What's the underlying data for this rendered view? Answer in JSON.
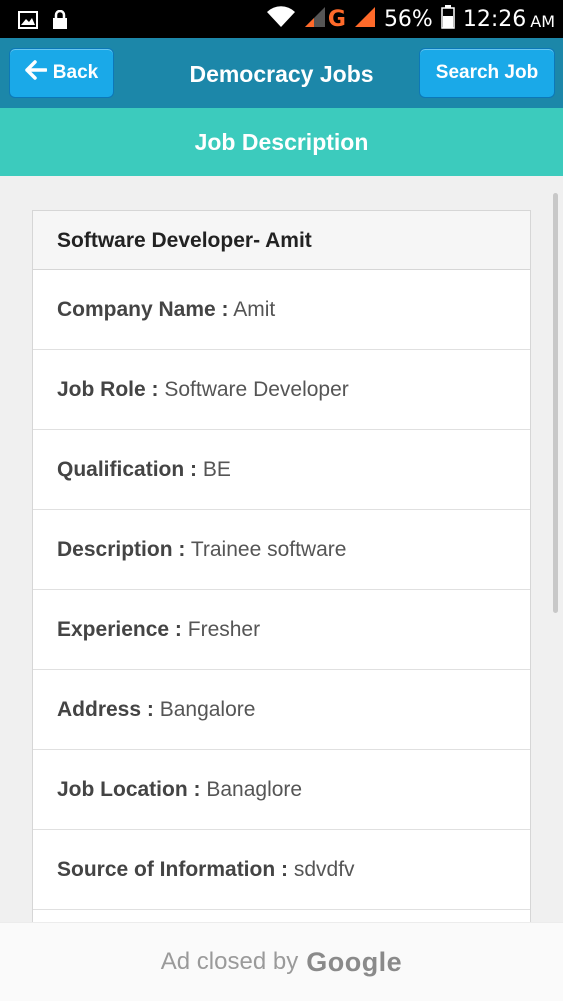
{
  "status_bar": {
    "battery": "56%",
    "time": "12:26",
    "ampm": "AM",
    "network_letter": "G",
    "icons": [
      "image-icon",
      "lock-icon",
      "wifi-icon",
      "signal-icon",
      "signal-icon",
      "battery-icon"
    ]
  },
  "header": {
    "back_label": "Back",
    "title": "Democracy Jobs",
    "search_label": "Search Job"
  },
  "subheader": {
    "title": "Job Description"
  },
  "job": {
    "title": "Software Developer- Amit",
    "fields": [
      {
        "label": "Company Name :",
        "value": "Amit"
      },
      {
        "label": "Job Role :",
        "value": "Software Developer"
      },
      {
        "label": "Qualification :",
        "value": "BE"
      },
      {
        "label": "Description :",
        "value": "Trainee software"
      },
      {
        "label": "Experience :",
        "value": "Fresher"
      },
      {
        "label": "Address :",
        "value": "Bangalore"
      },
      {
        "label": "Job Location :",
        "value": "Banaglore"
      },
      {
        "label": "Source of Information :",
        "value": "sdvdfv"
      }
    ]
  },
  "ad": {
    "text": "Ad closed by",
    "brand": "Google"
  },
  "colors": {
    "header": "#1c87a9",
    "button": "#1aa9e8",
    "subheader": "#3ccbbd",
    "network_letter": "#ff6a2a"
  }
}
